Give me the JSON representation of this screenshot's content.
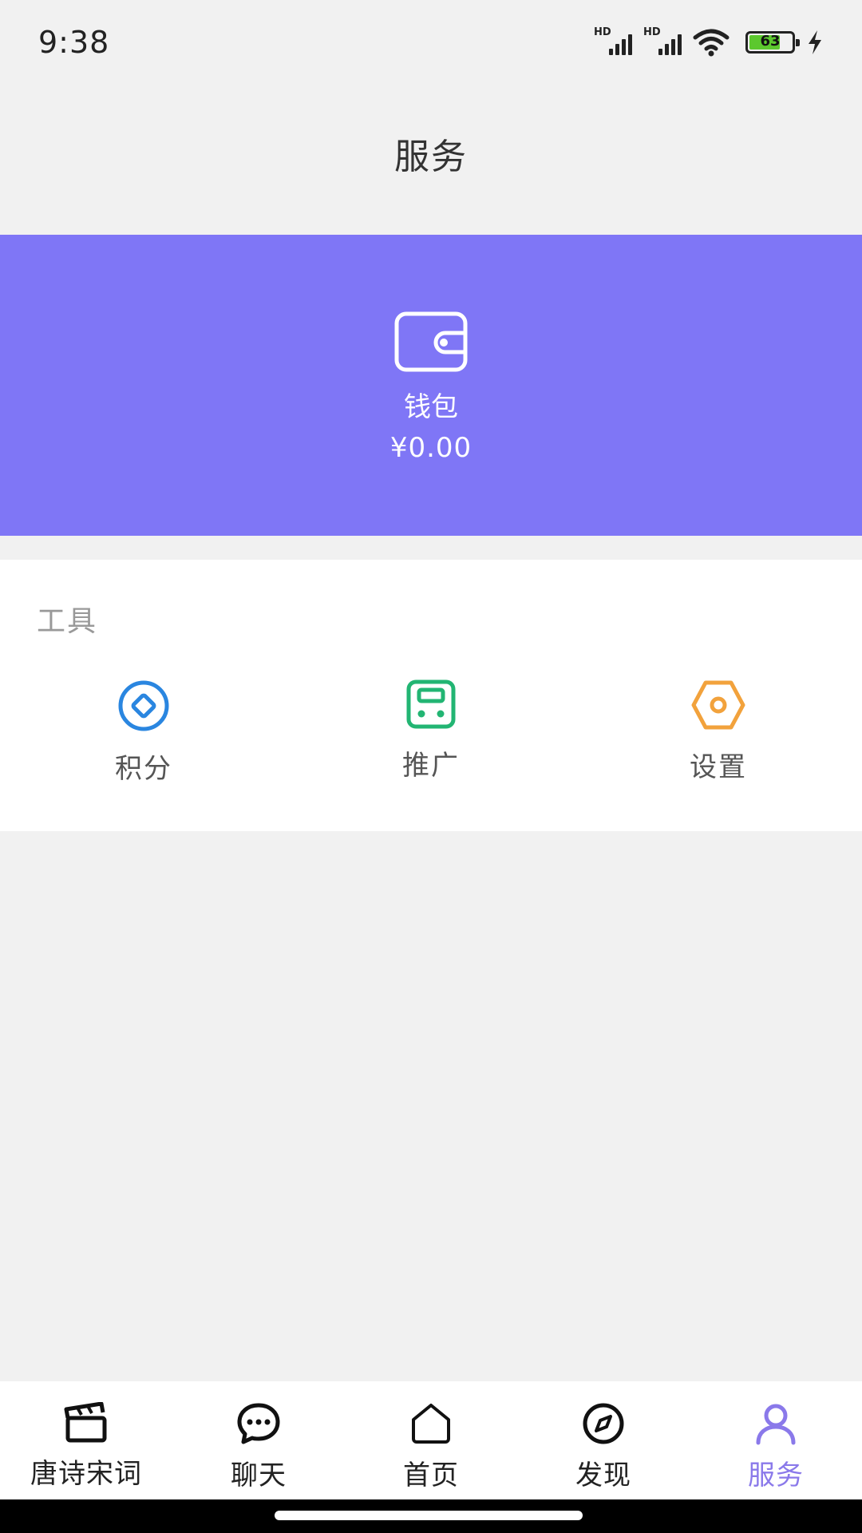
{
  "status": {
    "time": "9:38",
    "hd1": "HD",
    "hd2": "HD",
    "battery": "63"
  },
  "header": {
    "title": "服务"
  },
  "wallet": {
    "icon": "wallet-icon",
    "label": "钱包",
    "amount": "¥0.00",
    "bg_color": "#7f76f6"
  },
  "tools": {
    "title": "工具",
    "items": [
      {
        "icon": "points-icon",
        "label": "积分",
        "color": "#2a86e0"
      },
      {
        "icon": "promote-icon",
        "label": "推广",
        "color": "#22b573"
      },
      {
        "icon": "settings-icon",
        "label": "设置",
        "color": "#f2a23c"
      }
    ]
  },
  "nav": {
    "items": [
      {
        "icon": "clapperboard-icon",
        "label": "唐诗宋词"
      },
      {
        "icon": "chat-icon",
        "label": "聊天"
      },
      {
        "icon": "home-icon",
        "label": "首页"
      },
      {
        "icon": "compass-icon",
        "label": "发现"
      },
      {
        "icon": "user-icon",
        "label": "服务",
        "active": true
      }
    ],
    "active_color": "#8a79ea"
  }
}
